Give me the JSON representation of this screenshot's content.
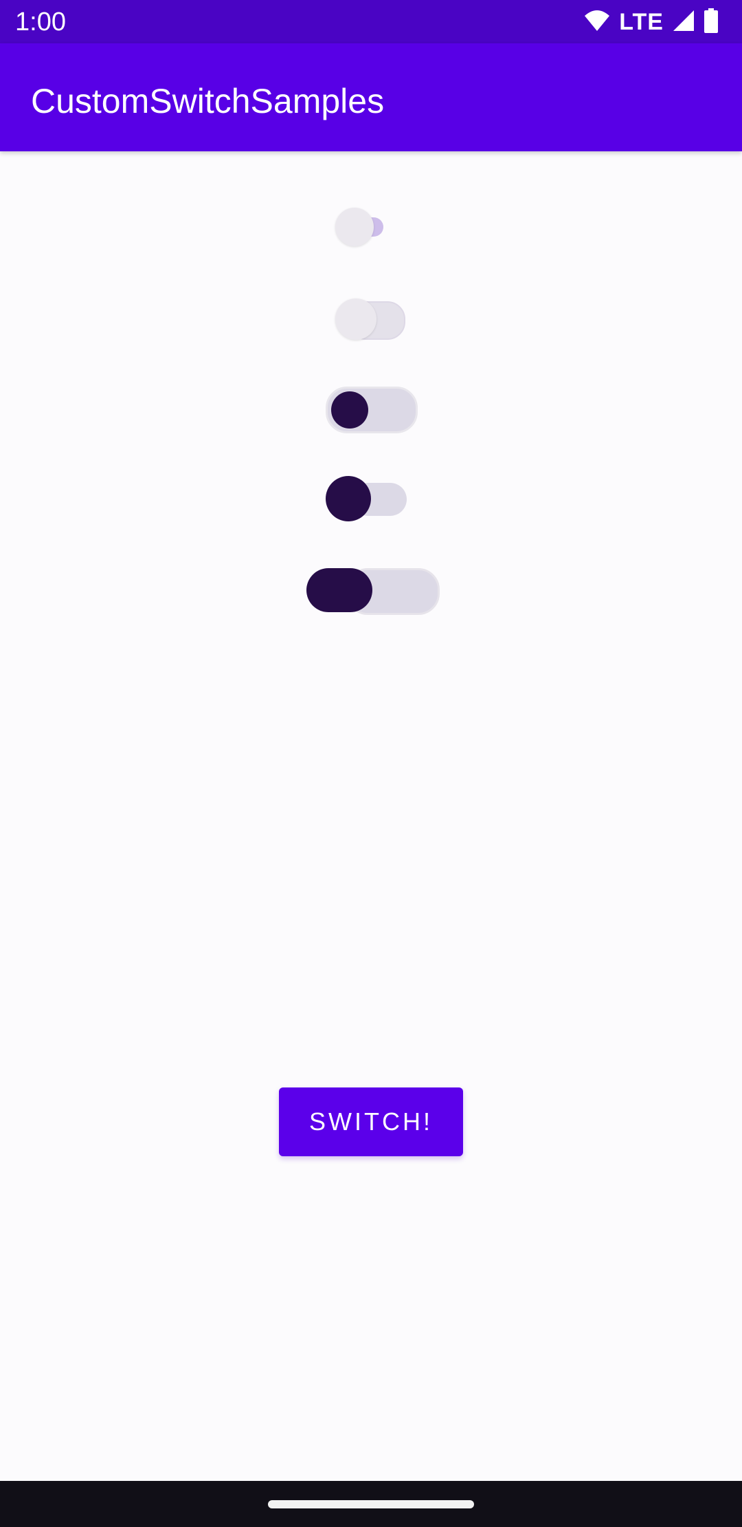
{
  "status_bar": {
    "time": "1:00",
    "network": "LTE",
    "icons": [
      "wifi-icon",
      "signal-icon",
      "battery-icon"
    ],
    "background": "#4a04c4"
  },
  "app_bar": {
    "title": "CustomSwitchSamples",
    "background": "#5800e6"
  },
  "switches": [
    {
      "name": "switch-1",
      "checked": false
    },
    {
      "name": "switch-2",
      "checked": false
    },
    {
      "name": "switch-3",
      "checked": false
    },
    {
      "name": "switch-4",
      "checked": false
    },
    {
      "name": "switch-5",
      "checked": false
    }
  ],
  "button": {
    "label": "SWITCH!",
    "color": "#5b00ea"
  },
  "colors": {
    "thumb_dark": "#260d48",
    "track": "#dcd9e6",
    "background": "#fcfbfd"
  }
}
